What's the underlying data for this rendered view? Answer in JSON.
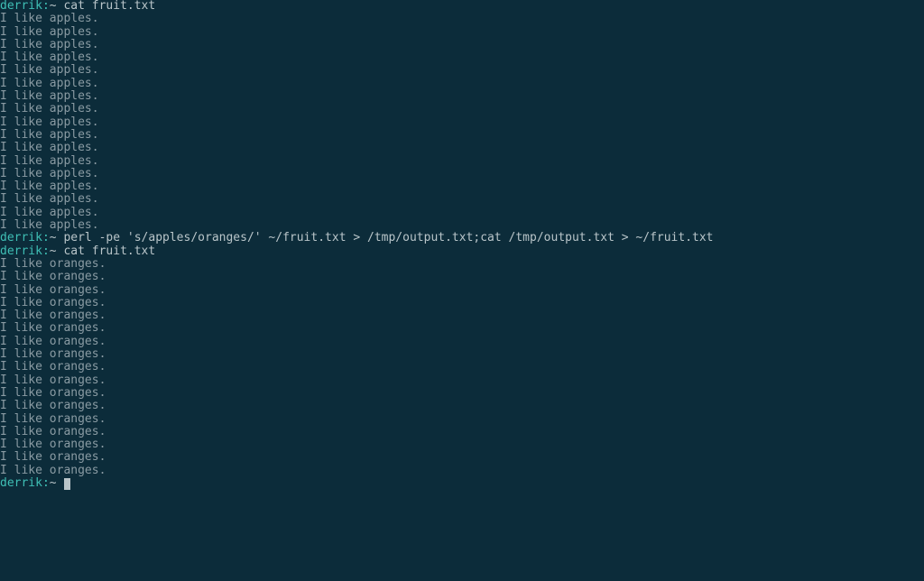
{
  "prompt": {
    "user": "derrik",
    "sep": ":",
    "sym": "~ "
  },
  "blocks": [
    {
      "command": "cat fruit.txt",
      "output": [
        "I like apples.",
        "I like apples.",
        "I like apples.",
        "I like apples.",
        "I like apples.",
        "I like apples.",
        "I like apples.",
        "I like apples.",
        "I like apples.",
        "I like apples.",
        "I like apples.",
        "I like apples.",
        "I like apples.",
        "I like apples.",
        "I like apples.",
        "I like apples.",
        "I like apples."
      ]
    },
    {
      "command": "perl -pe 's/apples/oranges/' ~/fruit.txt > /tmp/output.txt;cat /tmp/output.txt > ~/fruit.txt",
      "output": []
    },
    {
      "command": "cat fruit.txt",
      "output": [
        "I like oranges.",
        "I like oranges.",
        "I like oranges.",
        "I like oranges.",
        "I like oranges.",
        "I like oranges.",
        "I like oranges.",
        "I like oranges.",
        "I like oranges.",
        "I like oranges.",
        "I like oranges.",
        "I like oranges.",
        "I like oranges.",
        "I like oranges.",
        "I like oranges.",
        "I like oranges.",
        "I like oranges."
      ]
    }
  ],
  "cursor_line": true
}
